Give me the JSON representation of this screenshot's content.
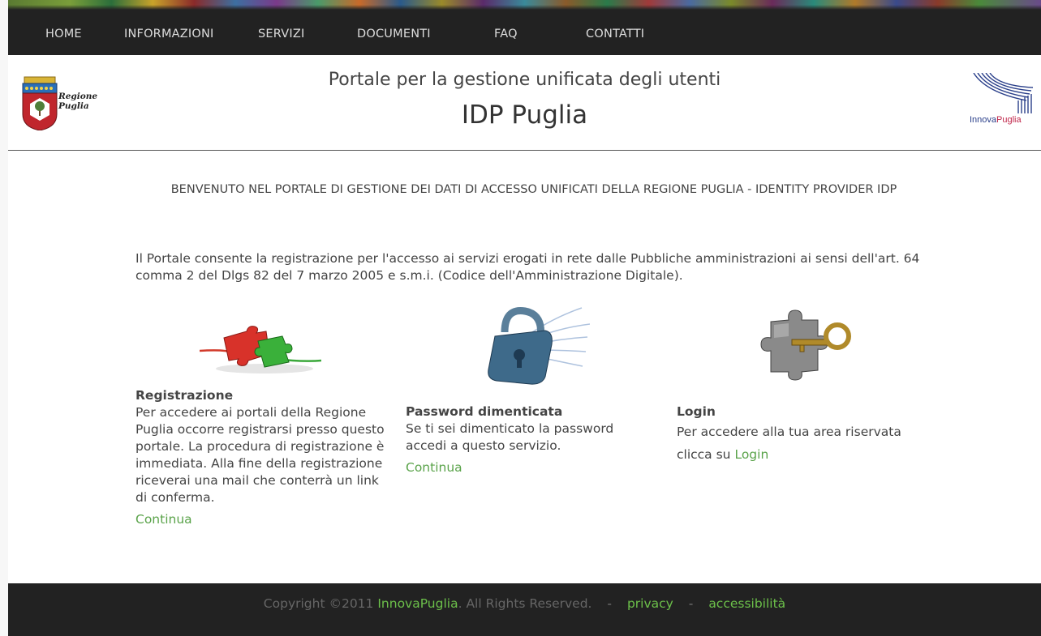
{
  "nav": {
    "items": [
      {
        "label": "HOME"
      },
      {
        "label": "INFORMAZIONI"
      },
      {
        "label": "SERVIZI"
      },
      {
        "label": "DOCUMENTI"
      },
      {
        "label": "FAQ"
      },
      {
        "label": "CONTATTI"
      }
    ]
  },
  "header": {
    "subtitle": "Portale per la gestione unificata degli utenti",
    "title": "IDP Puglia",
    "logo_left_text_line1": "Regione",
    "logo_left_text_line2": "Puglia",
    "logo_right_text_a": "Innova",
    "logo_right_text_b": "Puglia"
  },
  "main": {
    "welcome": "BENVENUTO NEL PORTALE DI GESTIONE DEI DATI DI ACCESSO UNIFICATI DELLA REGIONE PUGLIA - IDENTITY PROVIDER IDP",
    "intro": "Il Portale consente la registrazione per l'accesso ai servizi erogati in rete dalle Pubbliche amministrazioni ai sensi dell'art. 64 comma 2 del Dlgs 82 del 7 marzo 2005 e s.m.i. (Codice dell'Amministrazione Digitale).",
    "registrazione": {
      "title": "Registrazione",
      "text": "Per accedere ai portali della Regione Puglia occorre registrarsi presso questo portale. La procedura di registrazione è immediata. Alla fine della registrazione riceverai una mail che conterrà un link di conferma.",
      "link": "Continua",
      "icon": "puzzle-icon"
    },
    "password": {
      "title": "Password dimenticata",
      "text": "Se ti sei dimenticato la password accedi a questo servizio.",
      "link": "Continua",
      "icon": "padlock-icon"
    },
    "login": {
      "title": "Login",
      "text_prefix": "Per accedere alla tua area riservata clicca su",
      "link": "Login",
      "icon": "key-puzzle-icon"
    }
  },
  "footer": {
    "copyright_prefix": "Copyright ©2011",
    "brand": "InnovaPuglia",
    "copyright_suffix": ". All Rights Reserved.",
    "separator": "-",
    "privacy": "privacy",
    "accessibility": "accessibilità"
  },
  "colors": {
    "navbar_bg": "#222222",
    "link_green": "#5aa34a",
    "footer_bg": "#222222"
  }
}
